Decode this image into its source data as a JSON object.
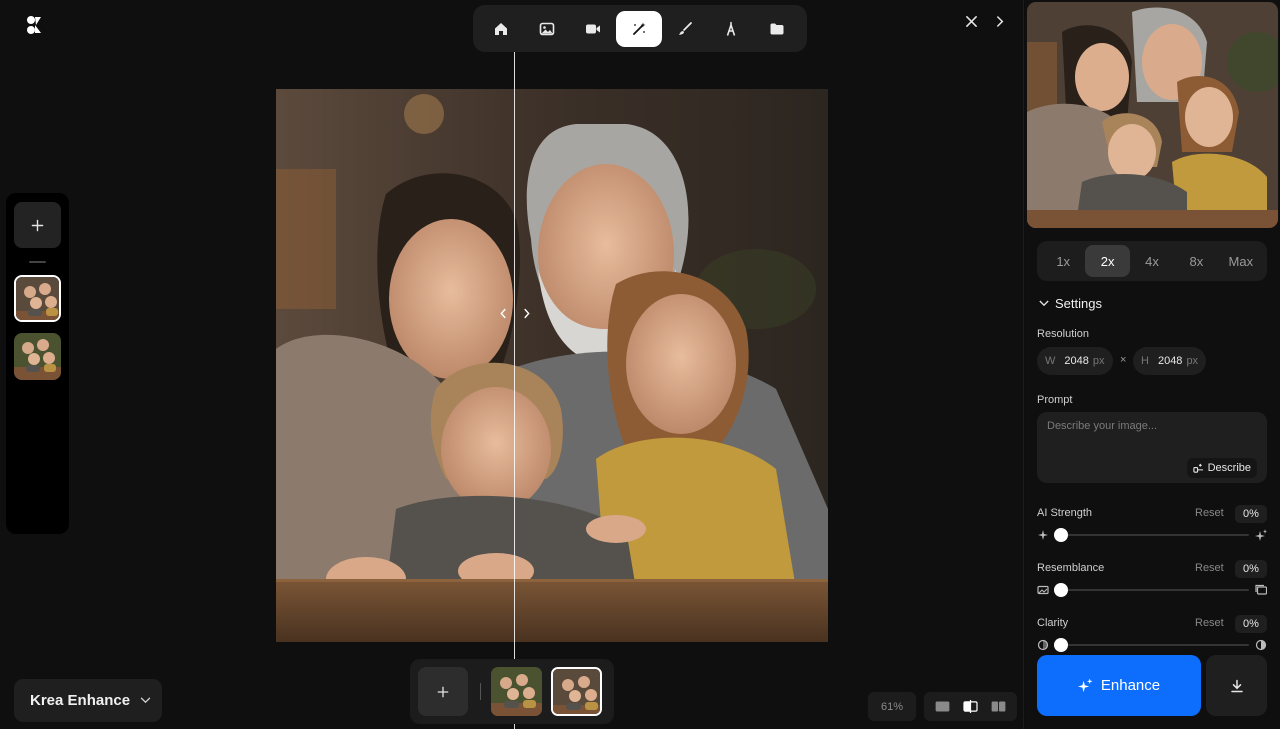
{
  "toolbar": {
    "tools": [
      {
        "icon": "home-icon"
      },
      {
        "icon": "image-icon"
      },
      {
        "icon": "video-icon"
      },
      {
        "icon": "enhance-wand-icon",
        "active": true
      },
      {
        "icon": "brush-icon"
      },
      {
        "icon": "train-icon"
      },
      {
        "icon": "folder-icon"
      }
    ]
  },
  "canvas": {
    "zoom_label": "61%",
    "compare_position": 0.43
  },
  "model_selector": {
    "label": "Krea Enhance"
  },
  "panel": {
    "scales": [
      "1x",
      "2x",
      "4x",
      "8x",
      "Max"
    ],
    "active_scale": "2x",
    "settings_label": "Settings",
    "resolution": {
      "label": "Resolution",
      "w_key": "W",
      "w_value": "2048",
      "h_key": "H",
      "h_value": "2048",
      "unit": "px",
      "separator": "×"
    },
    "prompt": {
      "label": "Prompt",
      "placeholder": "Describe your image...",
      "value": "",
      "describe_label": "Describe"
    },
    "sliders": [
      {
        "name": "AI Strength",
        "reset": "Reset",
        "value": "0%",
        "level": 0
      },
      {
        "name": "Resemblance",
        "reset": "Reset",
        "value": "0%",
        "level": 0
      },
      {
        "name": "Clarity",
        "reset": "Reset",
        "value": "0%",
        "level": 0
      }
    ],
    "enhance_label": "Enhance"
  },
  "colors": {
    "accent": "#0d6efd",
    "background": "#0f0f0f",
    "surface": "#1f1f1f"
  }
}
